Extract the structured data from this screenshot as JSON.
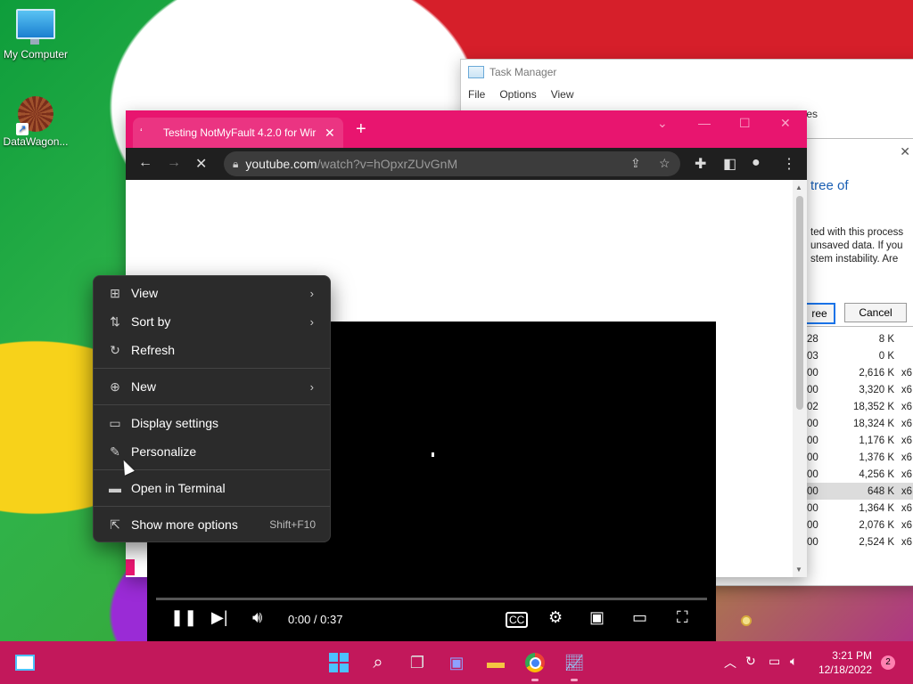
{
  "desktop": {
    "icons": [
      {
        "label": "My Computer"
      },
      {
        "label": "DataWagon..."
      }
    ]
  },
  "task_manager": {
    "title": "Task Manager",
    "menu": [
      "File",
      "Options",
      "View"
    ],
    "tab_fragment": "ces",
    "dialog": {
      "heading": "tree of",
      "body": "ted with this process unsaved data. If you stem instability. Are",
      "primary_button": "ree",
      "cancel_button": "Cancel"
    },
    "rows": [
      {
        "id": "28",
        "mem": "8 K",
        "arch": ""
      },
      {
        "id": "03",
        "mem": "0 K",
        "arch": ""
      },
      {
        "id": "00",
        "mem": "2,616 K",
        "arch": "x6"
      },
      {
        "id": "00",
        "mem": "3,320 K",
        "arch": "x6"
      },
      {
        "id": "02",
        "mem": "18,352 K",
        "arch": "x6"
      },
      {
        "id": "00",
        "mem": "18,324 K",
        "arch": "x6"
      },
      {
        "id": "00",
        "mem": "1,176 K",
        "arch": "x6"
      },
      {
        "id": "00",
        "mem": "1,376 K",
        "arch": "x6"
      },
      {
        "id": "00",
        "mem": "4,256 K",
        "arch": "x6"
      },
      {
        "id": "00",
        "mem": "648 K",
        "arch": "x6"
      },
      {
        "id": "00",
        "mem": "1,364 K",
        "arch": "x6"
      },
      {
        "id": "00",
        "mem": "2,076 K",
        "arch": "x6"
      },
      {
        "id": "00",
        "mem": "2,524 K",
        "arch": "x6"
      }
    ]
  },
  "browser": {
    "tab_title": "Testing NotMyFault 4.2.0 for Wir",
    "url_host": "youtube.com",
    "url_path": "/watch?v=hOpxrZUvGnM",
    "video": {
      "time": "0:00 / 0:37",
      "progress": 0
    }
  },
  "context_menu": {
    "items": [
      {
        "label": "View",
        "icon": "grid-icon"
      },
      {
        "label": "Sort by",
        "icon": "sort-icon"
      },
      {
        "label": "Refresh",
        "icon": "refresh-icon"
      },
      {
        "label": "New",
        "icon": "plus-circle-icon"
      },
      {
        "label": "Display settings",
        "icon": "display-icon"
      },
      {
        "label": "Personalize",
        "icon": "brush-icon"
      },
      {
        "label": "Open in Terminal",
        "icon": "terminal-icon"
      },
      {
        "label": "Show more options",
        "icon": "share-icon",
        "shortcut": "Shift+F10"
      }
    ]
  },
  "taskbar": {
    "time": "3:21 PM",
    "date": "12/18/2022",
    "notification_count": "2"
  },
  "colors": {
    "accent_pink": "#e8156f",
    "taskbar": "#c2185b",
    "menu_bg": "#2b2b2b"
  }
}
